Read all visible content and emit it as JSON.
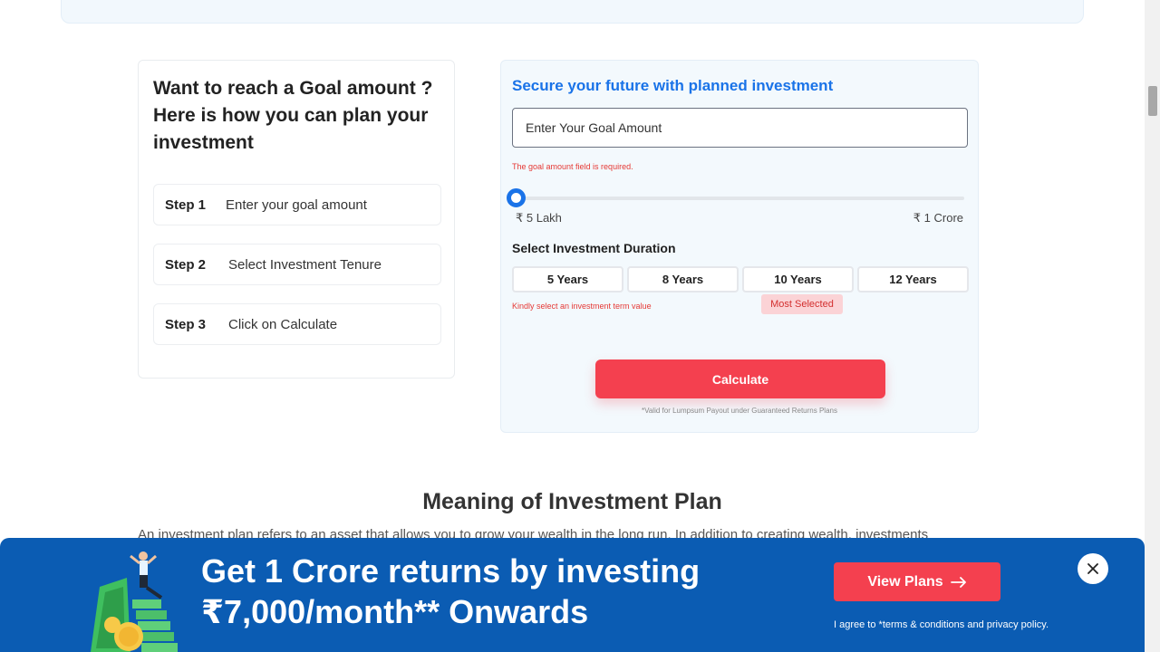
{
  "steps": {
    "title": "Want to reach a Goal amount ? Here is how you can plan your investment",
    "items": [
      {
        "num": "Step 1",
        "text": "Enter your goal amount"
      },
      {
        "num": "Step 2",
        "text": "Select Investment Tenure"
      },
      {
        "num": "Step 3",
        "text": "Click on Calculate"
      }
    ]
  },
  "calculator": {
    "title": "Secure your future with planned investment",
    "goal_placeholder": "Enter Your Goal Amount",
    "goal_value": "",
    "goal_error": "The goal amount field is required.",
    "slider": {
      "min_label": "₹ 5 Lakh",
      "max_label": "₹ 1 Crore",
      "position_fraction": 0
    },
    "duration_label": "Select Investment Duration",
    "durations": [
      "5 Years",
      "8 Years",
      "10 Years",
      "12 Years"
    ],
    "duration_error": "Kindly select an investment term value",
    "most_selected_badge": "Most Selected",
    "calculate_label": "Calculate",
    "note": "*Valid for Lumpsum Payout under Guaranteed Returns Plans"
  },
  "section": {
    "title": "Meaning of Investment Plan",
    "text": "An investment plan refers to an asset that allows you to grow your wealth in the long run. In addition to creating wealth, investments"
  },
  "banner": {
    "line1": "Get 1 Crore returns by investing",
    "line2": "₹7,000/month** Onwards",
    "button_label": "View Plans",
    "agree_text": "I agree to *terms & conditions and privacy policy."
  },
  "colors": {
    "accent_blue": "#1a73e8",
    "cta_red": "#f4404f",
    "banner_blue": "#0b5cb3",
    "error_red": "#e53935"
  }
}
